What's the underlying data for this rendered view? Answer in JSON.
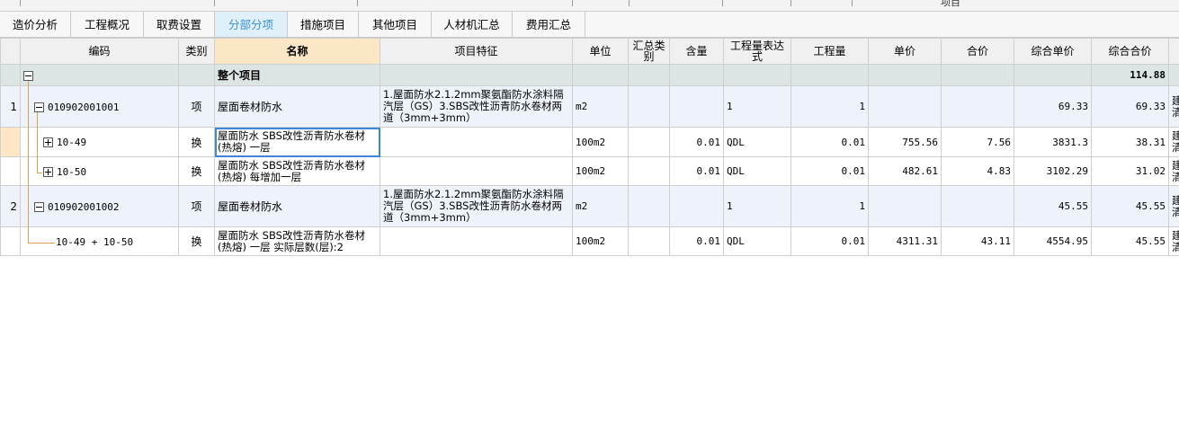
{
  "topstrip": {
    "title": "项目"
  },
  "tabs": [
    {
      "label": "造价分析",
      "active": false
    },
    {
      "label": "工程概况",
      "active": false
    },
    {
      "label": "取费设置",
      "active": false
    },
    {
      "label": "分部分项",
      "active": true
    },
    {
      "label": "措施项目",
      "active": false
    },
    {
      "label": "其他项目",
      "active": false
    },
    {
      "label": "人材机汇总",
      "active": false
    },
    {
      "label": "费用汇总",
      "active": false
    }
  ],
  "columns": {
    "code": "编码",
    "category": "类别",
    "name": "名称",
    "feature": "项目特征",
    "unit": "单位",
    "summary_line1": "汇总类",
    "summary_line2": "别",
    "content": "含量",
    "expr_line1": "工程量表达",
    "expr_line2": "式",
    "qty": "工程量",
    "price": "单价",
    "total": "合价",
    "comp_price": "综合单价",
    "comp_total": "综合合价"
  },
  "total_row": {
    "name": "整个项目",
    "comp_total": "114.88"
  },
  "rows": [
    {
      "idx": "1",
      "code": "010902001001",
      "category": "项",
      "name": "屋面卷材防水",
      "feature": "1.屋面防水2.1.2mm聚氨酯防水涂料隔汽层（GS）3.SBS改性沥青防水卷材两道（3mm+3mm）",
      "unit": "m2",
      "content": "",
      "expr": "1",
      "qty": "1",
      "price": "",
      "total": "",
      "comp_price": "69.33",
      "comp_total": "69.33",
      "last": "建清"
    },
    {
      "idx": "",
      "code": "10-49",
      "category": "换",
      "name": "屋面防水 SBS改性沥青防水卷材(热熔) 一层",
      "feature": "",
      "unit": "100m2",
      "content": "0.01",
      "expr": "QDL",
      "qty": "0.01",
      "price": "755.56",
      "total": "7.56",
      "comp_price": "3831.3",
      "comp_total": "38.31",
      "last": "建清"
    },
    {
      "idx": "",
      "code": "10-50",
      "category": "换",
      "name": "屋面防水 SBS改性沥青防水卷材(热熔) 每增加一层",
      "feature": "",
      "unit": "100m2",
      "content": "0.01",
      "expr": "QDL",
      "qty": "0.01",
      "price": "482.61",
      "total": "4.83",
      "comp_price": "3102.29",
      "comp_total": "31.02",
      "last": "建清"
    },
    {
      "idx": "2",
      "code": "010902001002",
      "category": "项",
      "name": "屋面卷材防水",
      "feature": "1.屋面防水2.1.2mm聚氨酯防水涂料隔汽层（GS）3.SBS改性沥青防水卷材两道（3mm+3mm）",
      "unit": "m2",
      "content": "",
      "expr": "1",
      "qty": "1",
      "price": "",
      "total": "",
      "comp_price": "45.55",
      "comp_total": "45.55",
      "last": "建清"
    },
    {
      "idx": "",
      "code": "10-49 + 10-50",
      "category": "换",
      "name": "屋面防水 SBS改性沥青防水卷材(热熔) 一层  实际层数(层):2",
      "feature": "",
      "unit": "100m2",
      "content": "0.01",
      "expr": "QDL",
      "qty": "0.01",
      "price": "4311.31",
      "total": "43.11",
      "comp_price": "4554.95",
      "comp_total": "45.55",
      "last": "建清"
    }
  ],
  "colors": {
    "active_tab_bg": "#dff0fb",
    "active_tab_text": "#3a8fd6",
    "selected_header": "#fbe7c6",
    "item_row": "#eef3fb",
    "total_row": "#dde4e4",
    "edit_border": "#3c86d6"
  }
}
